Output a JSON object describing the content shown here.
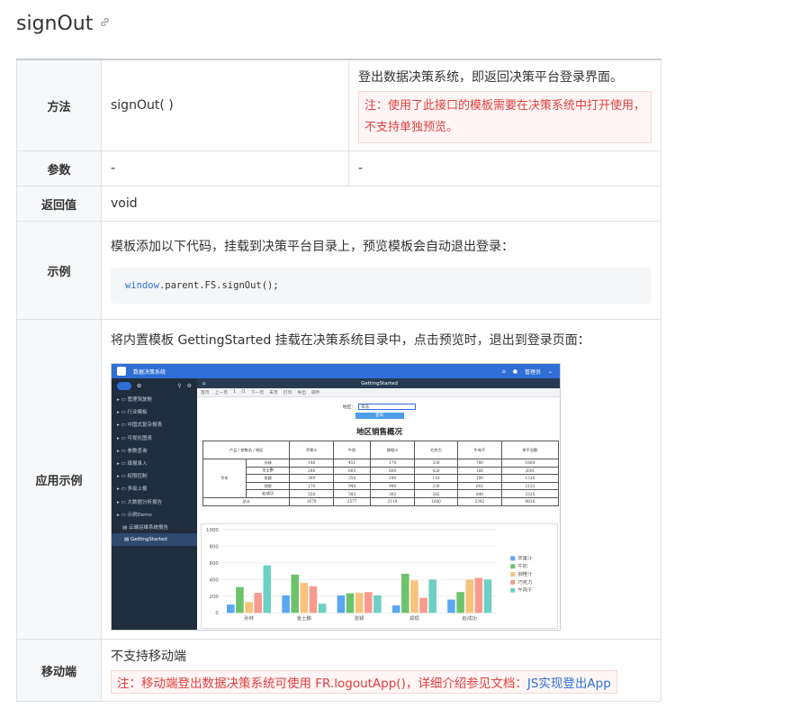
{
  "heading": {
    "title": "signOut",
    "link_icon": "link-icon"
  },
  "rows": {
    "method": {
      "label": "方法",
      "signature": "signOut( )",
      "desc": "登出数据决策系统，即返回决策平台登录界面。",
      "note": "注：使用了此接口的模板需要在决策系统中打开使用，不支持单独预览。"
    },
    "params": {
      "label": "参数",
      "value1": "-",
      "value2": "-"
    },
    "returns": {
      "label": "返回值",
      "value": "void"
    },
    "example": {
      "label": "示例",
      "intro": "模板添加以下代码，挂载到决策平台目录上，预览模板会自动退出登录：",
      "code_obj": "window",
      "code_rest": ".parent.FS.signOut();"
    },
    "app_example": {
      "label": "应用示例",
      "intro": "将内置模板 GettingStarted 挂载在决策系统目录中，点击预览时，退出到登录页面："
    },
    "mobile": {
      "label": "移动端",
      "value": "不支持移动端",
      "note_prefix": "注：移动端登出数据决策系统可使用 FR.logoutApp()，详细介绍参见文档：",
      "note_link": "JS实现登出App"
    }
  },
  "screenshot": {
    "brand": "数据决策系统",
    "user": "管理员",
    "tab_title": "GettingStarted",
    "toolbar": [
      "首页",
      "上一页",
      "1",
      "/1",
      "下一页",
      "末页",
      "打印",
      "导出",
      "邮件"
    ],
    "filter_label": "地区：",
    "filter_value": "华东",
    "query_button": "查询",
    "menu": [
      "管理驾驶舱",
      "行业模板",
      "中国式复杂报表",
      "可视化图表",
      "参数查询",
      "填报录入",
      "权限控制",
      "多级上报",
      "大数据分析报告",
      "示例Demo",
      "云端运维系统报告",
      "GettingStarted"
    ],
    "report_title": "地区销售概况",
    "header_row": [
      "",
      "苹果汁",
      "牛奶",
      "柳橙汁",
      "巧克力",
      "牛肉干",
      "饼干总额"
    ],
    "header_corner": [
      "产品",
      "销售员",
      "地区"
    ],
    "region": "华东",
    "table_rows": [
      [
        "孙林",
        "140",
        "451",
        "178",
        "330",
        "780",
        "1869"
      ],
      [
        "金士鹏",
        "296",
        "605",
        "609",
        "420",
        "106",
        "2001"
      ],
      [
        "张颖",
        "369",
        "354",
        "240",
        "110",
        "190",
        "1314"
      ],
      [
        "郑珉",
        "170",
        "944",
        "940",
        "230",
        "602",
        "2122"
      ],
      [
        "赵成功",
        "550",
        "583",
        "362",
        "282",
        "840",
        "2325"
      ]
    ],
    "total_row": [
      "总计",
      "1679",
      "2577",
      "2119",
      "1600",
      "2342",
      "9818"
    ]
  },
  "chart_data": {
    "type": "bar",
    "categories": [
      "孙林",
      "金士鹏",
      "张颖",
      "郑珉",
      "赵成功"
    ],
    "series": [
      {
        "name": "苹果汁",
        "values": [
          100,
          210,
          210,
          90,
          160
        ],
        "color": "#5aa7f3"
      },
      {
        "name": "牛奶",
        "values": [
          310,
          460,
          235,
          470,
          250
        ],
        "color": "#6cc36c"
      },
      {
        "name": "柳橙汁",
        "values": [
          130,
          360,
          240,
          390,
          400
        ],
        "color": "#f9c27a"
      },
      {
        "name": "巧克力",
        "values": [
          240,
          320,
          250,
          180,
          420
        ],
        "color": "#f99a8e"
      },
      {
        "name": "牛肉干",
        "values": [
          570,
          110,
          210,
          400,
          400
        ],
        "color": "#6dd0c4"
      }
    ],
    "ylim": [
      0,
      1000
    ],
    "yticks": [
      0,
      200,
      400,
      600,
      800,
      1000
    ],
    "legend": "right",
    "grid": true
  }
}
